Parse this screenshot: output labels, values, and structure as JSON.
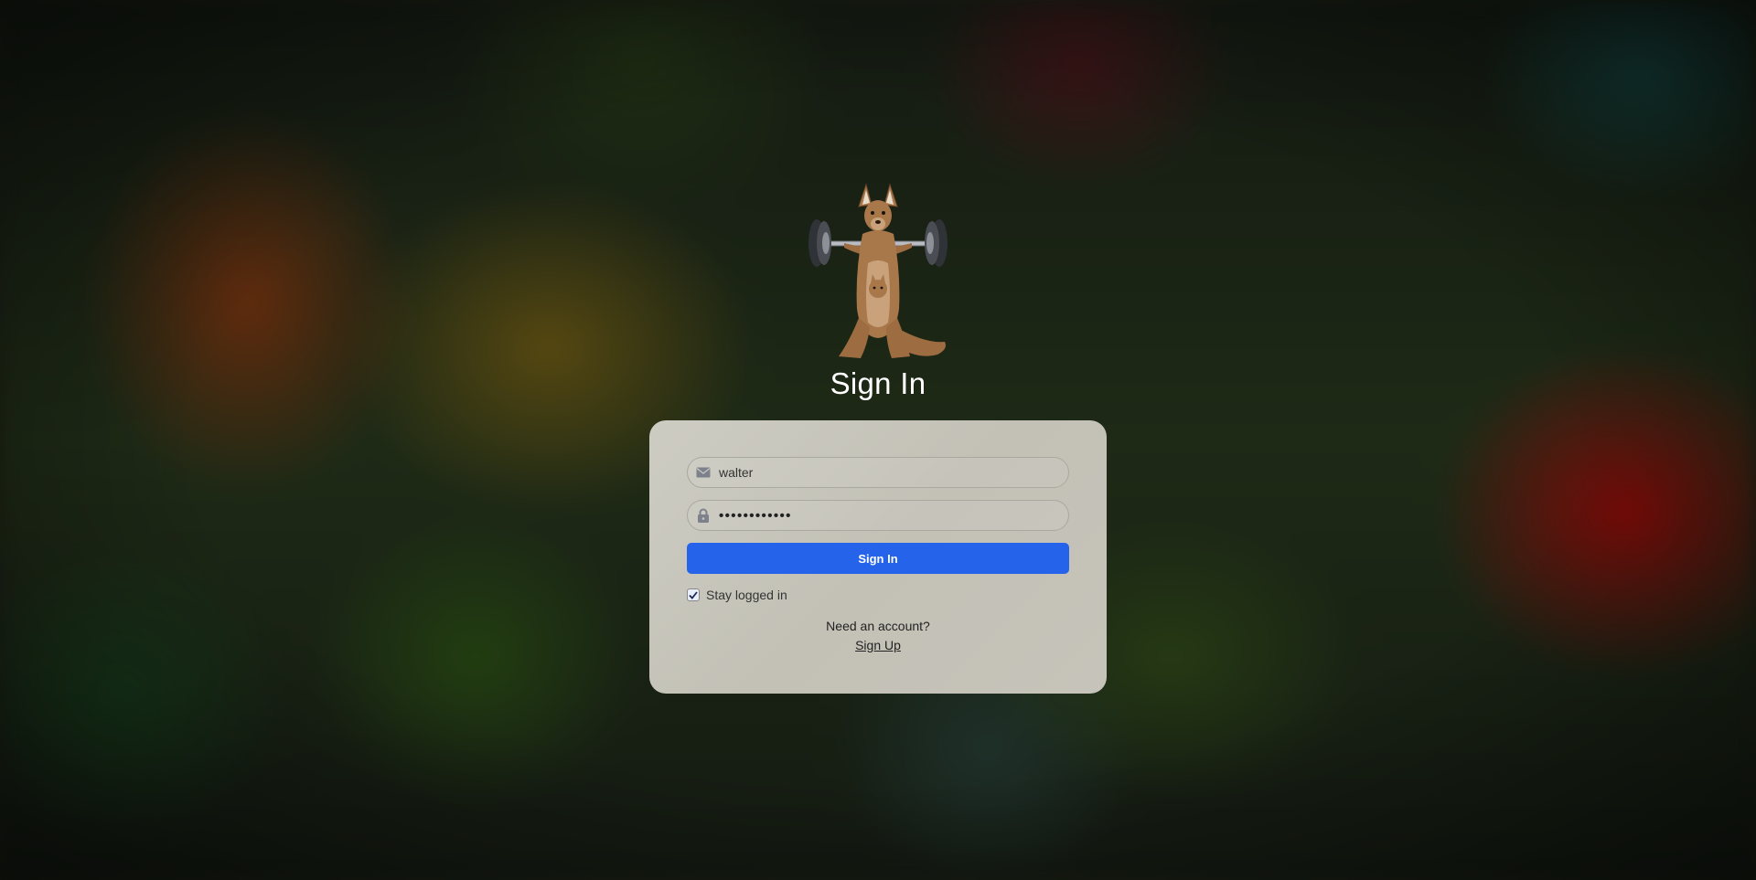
{
  "page": {
    "title": "Sign In",
    "logo_icon": "kangaroo-lifting-barbell-logo"
  },
  "form": {
    "username": {
      "value": "walter",
      "icon": "envelope-icon"
    },
    "password": {
      "masked_value": "••••••••••••",
      "icon": "lock-icon"
    },
    "submit_label": "Sign In",
    "remember": {
      "label": "Stay logged in",
      "checked": true
    }
  },
  "signup": {
    "prompt": "Need an account?",
    "link_label": "Sign Up"
  },
  "colors": {
    "accent": "#2563eb",
    "card": "#c9c7bd",
    "title": "#ffffff"
  }
}
